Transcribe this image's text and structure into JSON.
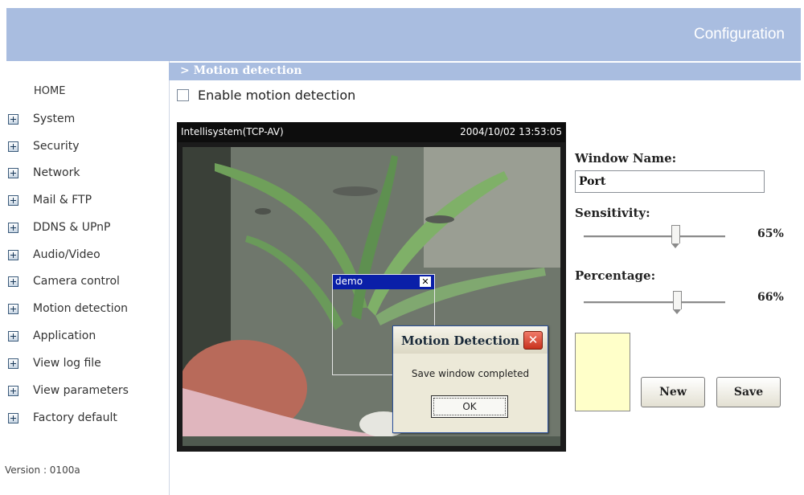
{
  "header": {
    "title": "Configuration"
  },
  "section": {
    "title": "> Motion detection"
  },
  "sidebar": {
    "home": "HOME",
    "items": [
      {
        "label": "System"
      },
      {
        "label": "Security"
      },
      {
        "label": "Network"
      },
      {
        "label": "Mail & FTP"
      },
      {
        "label": "DDNS & UPnP"
      },
      {
        "label": "Audio/Video"
      },
      {
        "label": "Camera control"
      },
      {
        "label": "Motion detection"
      },
      {
        "label": "Application"
      },
      {
        "label": "View log file"
      },
      {
        "label": "View parameters"
      },
      {
        "label": "Factory default"
      }
    ],
    "version": "Version : 0100a"
  },
  "enable": {
    "label": "Enable motion detection",
    "checked": false
  },
  "camera": {
    "name": "Intellisystem(TCP-AV)",
    "timestamp": "2004/10/02 13:53:05"
  },
  "motion_window": {
    "name": "demo",
    "close": "✕"
  },
  "dialog": {
    "title": "Motion Detection",
    "close": "✕",
    "message": "Save window completed",
    "ok": "OK"
  },
  "panel": {
    "window_name_label": "Window Name:",
    "window_name_value": "Port",
    "sensitivity_label": "Sensitivity:",
    "sensitivity_value": 65,
    "sensitivity_text": "65%",
    "percentage_label": "Percentage:",
    "percentage_value": 66,
    "percentage_text": "66%",
    "swatch_color": "#ffffc9",
    "new_label": "New",
    "save_label": "Save"
  },
  "colors": {
    "header": "#a9bde0",
    "motion_window_title": "#0a1fa8"
  }
}
